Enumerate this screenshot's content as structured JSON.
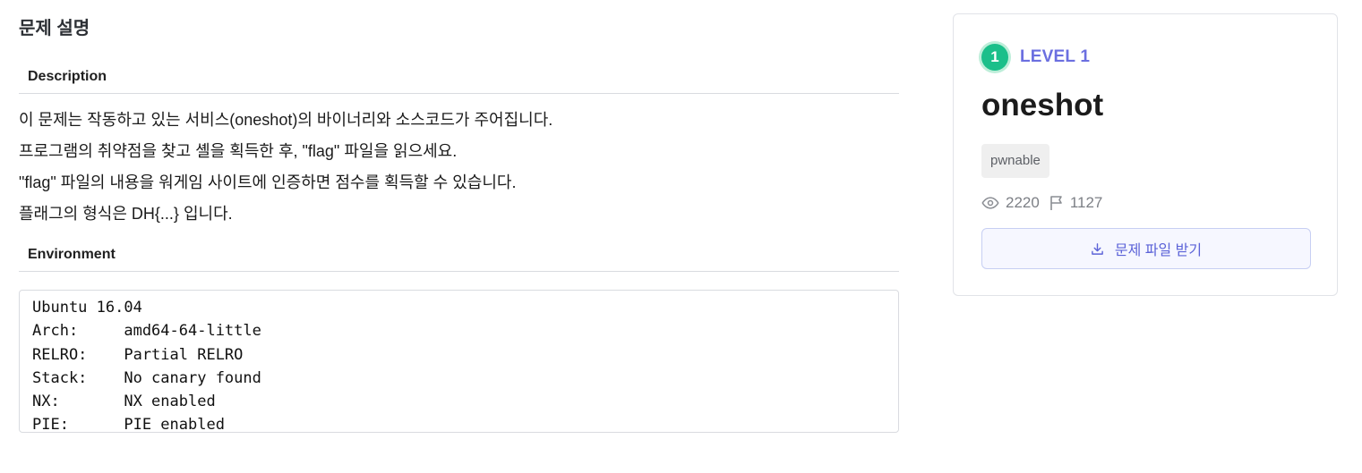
{
  "left": {
    "section_title": "문제 설명",
    "description_heading": "Description",
    "description_lines": [
      "이 문제는 작동하고 있는 서비스(oneshot)의 바이너리와 소스코드가 주어집니다.",
      "프로그램의 취약점을 찾고 셸을 획득한 후, \"flag\" 파일을 읽으세요.",
      "\"flag\" 파일의 내용을 워게임 사이트에 인증하면 점수를 획득할 수 있습니다.",
      "플래그의 형식은 DH{...} 입니다."
    ],
    "environment_heading": "Environment",
    "environment_lines": [
      "Ubuntu 16.04",
      "Arch:     amd64-64-little",
      "RELRO:    Partial RELRO",
      "Stack:    No canary found",
      "NX:       NX enabled",
      "PIE:      PIE enabled"
    ]
  },
  "card": {
    "level_number": "1",
    "level_label": "LEVEL 1",
    "title": "oneshot",
    "tag": "pwnable",
    "views": "2220",
    "solves": "1127",
    "download_label": "문제 파일 받기",
    "icons": {
      "views": "eye-icon",
      "solves": "flag-icon",
      "download": "download-icon"
    },
    "colors": {
      "level_badge": "#1bbf8a",
      "accent": "#6b6fe0",
      "button_bg": "#f6f7ff",
      "button_border": "#c7cff3"
    }
  }
}
